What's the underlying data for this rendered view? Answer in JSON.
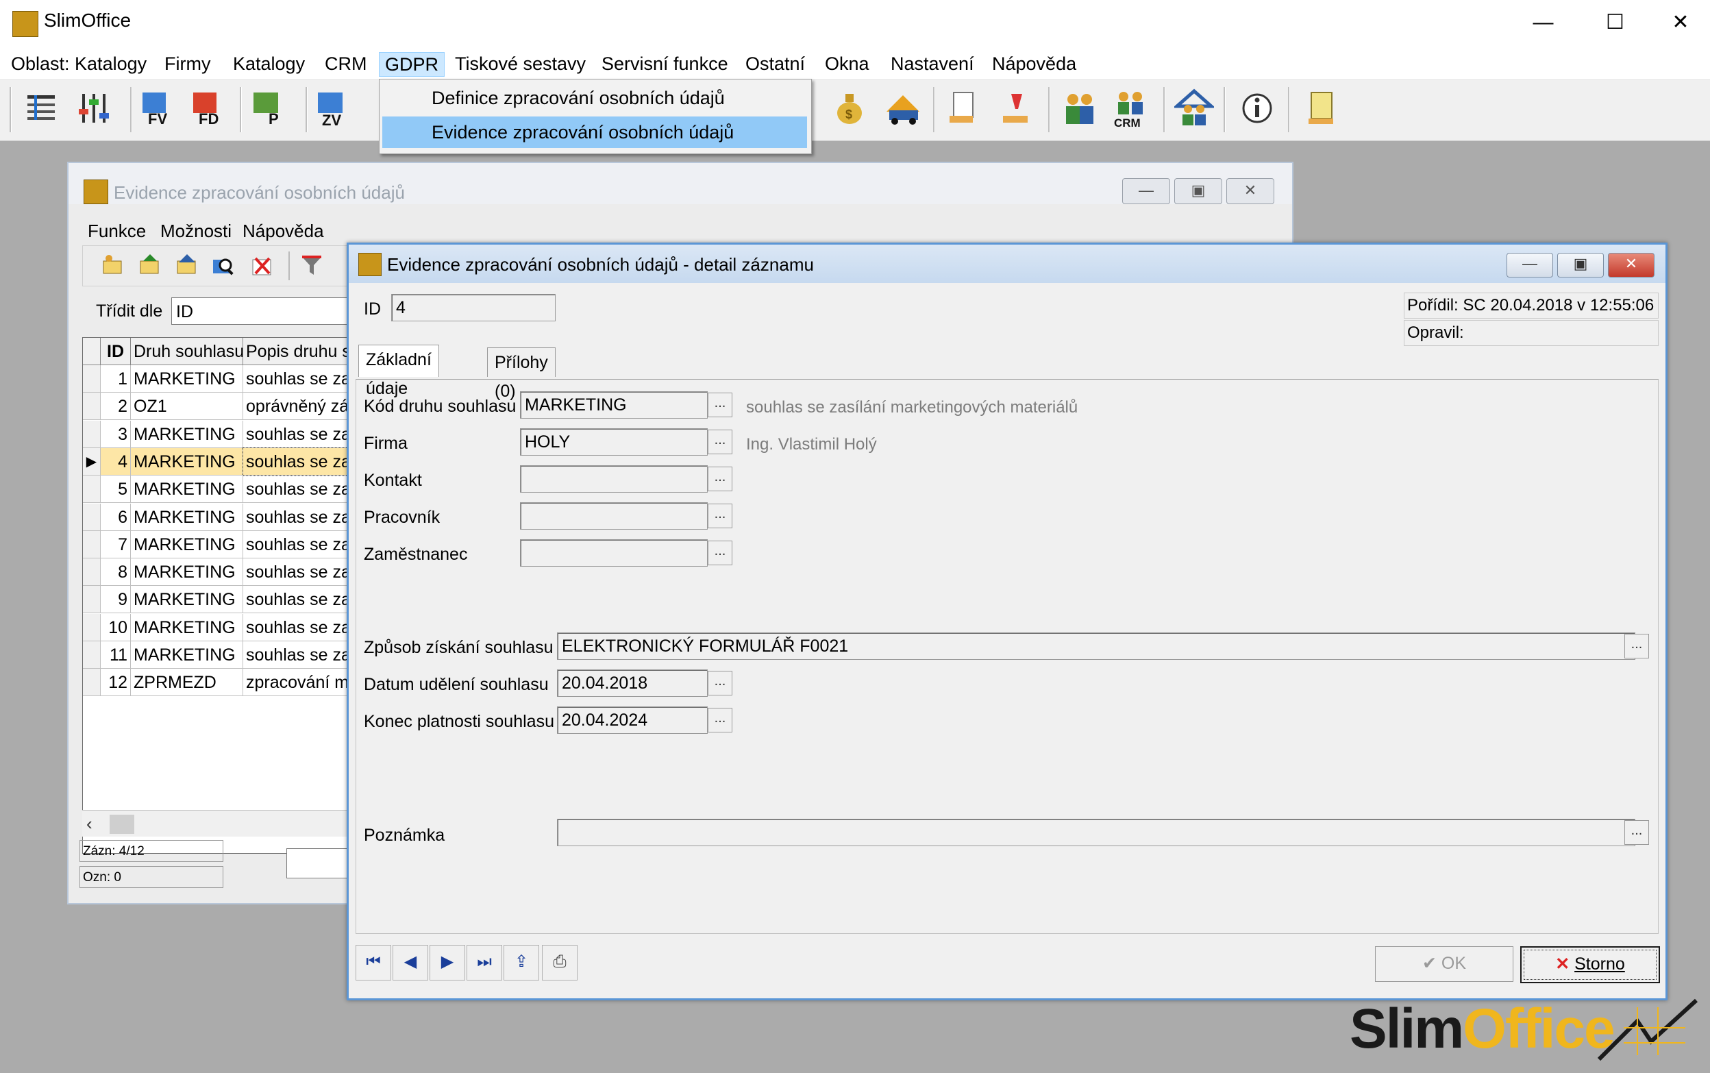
{
  "app": {
    "title": "SlimOffice",
    "minimize": "—",
    "maximize": "☐",
    "close": "✕"
  },
  "menubar": [
    {
      "label": "Oblast: Katalogy"
    },
    {
      "label": "Firmy"
    },
    {
      "label": "Katalogy"
    },
    {
      "label": "CRM"
    },
    {
      "label": "GDPR"
    },
    {
      "label": "Tiskové sestavy"
    },
    {
      "label": "Servisní funkce"
    },
    {
      "label": "Ostatní"
    },
    {
      "label": "Okna"
    },
    {
      "label": "Nastavení"
    },
    {
      "label": "Nápověda"
    }
  ],
  "gdpr_menu": {
    "items": [
      "Definice zpracování osobních údajů",
      "Evidence zpracování osobních údajů"
    ],
    "highlighted": "Evidence zpracování osobních údajů"
  },
  "toolbar_icons": [
    "list-icon",
    "filter-sliders-icon",
    "fv-invoice-icon",
    "fd-invoice-icon",
    "p-icon",
    "zv-icon",
    "moneybag-icon",
    "truck-icon",
    "document-hand-icon",
    "hand-tool-icon",
    "people-icon",
    "crm-icon",
    "house-people-icon",
    "info-icon",
    "report-icon"
  ],
  "list_window": {
    "title": "Evidence zpracování osobních údajů",
    "menu": [
      "Funkce",
      "Možnosti",
      "Nápověda"
    ],
    "sort_label": "Třídit dle",
    "sort_value": "ID",
    "columns": [
      "ID",
      "Druh souhlasu",
      "Popis druhu s"
    ],
    "rows": [
      {
        "id": "1",
        "druh": "MARKETING",
        "popis": "souhlas se za"
      },
      {
        "id": "2",
        "druh": "OZ1",
        "popis": "oprávněný zá"
      },
      {
        "id": "3",
        "druh": "MARKETING",
        "popis": "souhlas se za"
      },
      {
        "id": "4",
        "druh": "MARKETING",
        "popis": "souhlas se za"
      },
      {
        "id": "5",
        "druh": "MARKETING",
        "popis": "souhlas se za"
      },
      {
        "id": "6",
        "druh": "MARKETING",
        "popis": "souhlas se za"
      },
      {
        "id": "7",
        "druh": "MARKETING",
        "popis": "souhlas se za"
      },
      {
        "id": "8",
        "druh": "MARKETING",
        "popis": "souhlas se za"
      },
      {
        "id": "9",
        "druh": "MARKETING",
        "popis": "souhlas se za"
      },
      {
        "id": "10",
        "druh": "MARKETING",
        "popis": "souhlas se za"
      },
      {
        "id": "11",
        "druh": "MARKETING",
        "popis": "souhlas se za"
      },
      {
        "id": "12",
        "druh": "ZPRMEZD",
        "popis": "zpracování m"
      }
    ],
    "selected_row_id": "4",
    "status_records": "Zázn: 4/12",
    "status_marked": "Ozn: 0"
  },
  "detail_window": {
    "title": "Evidence zpracování osobních údajů - detail záznamu",
    "id_label": "ID",
    "id_value": "4",
    "created": "Pořídil: SC 20.04.2018 v 12:55:06",
    "modified": "Opravil:",
    "tabs": [
      "Základní údaje",
      "Přílohy (0)"
    ],
    "fields": {
      "kod_label": "Kód druhu souhlasu",
      "kod_value": "MARKETING",
      "kod_desc": "souhlas se zasílání marketingových materiálů",
      "firma_label": "Firma",
      "firma_value": "HOLY",
      "firma_desc": "Ing. Vlastimil Holý",
      "kontakt_label": "Kontakt",
      "pracovnik_label": "Pracovník",
      "zamestnanec_label": "Zaměstnanec",
      "zpusob_label": "Způsob získání souhlasu",
      "zpusob_value": "ELEKTRONICKÝ FORMULÁŘ F0021",
      "datum_label": "Datum udělení souhlasu",
      "datum_value": "20.04.2018",
      "konec_label": "Konec platnosti souhlasu",
      "konec_value": "20.04.2024",
      "poznamka_label": "Poznámka"
    },
    "ellipsis": "...",
    "ok_label": "OK",
    "storno_label": "Storno"
  },
  "logo": {
    "text_a": "Slim",
    "text_b": "Office"
  },
  "colors": {
    "accent_blue": "#5b96d6",
    "selection": "#91c9f7",
    "selected_row": "#fde6a6"
  }
}
